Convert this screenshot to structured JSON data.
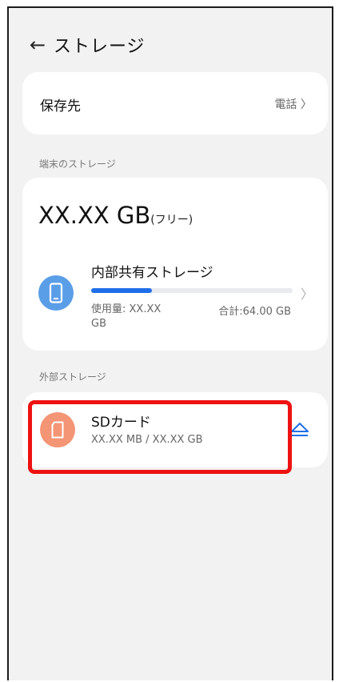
{
  "header": {
    "back_icon": "arrow-left-icon",
    "title": "ストレージ"
  },
  "save_location": {
    "label": "保存先",
    "value": "電話",
    "chevron_icon": "chevron-right-icon"
  },
  "device_section": {
    "heading": "端末のストレージ",
    "free_amount": "XX.XX GB",
    "free_label": "(フリー)",
    "internal": {
      "icon": "phone-icon",
      "name": "内部共有ストレージ",
      "used_fraction": 0.3,
      "used_text": "使用量: XX.XX GB",
      "total_text": "合計:64.00 GB",
      "chevron_icon": "chevron-right-icon"
    }
  },
  "external_section": {
    "heading": "外部ストレージ",
    "sd": {
      "icon": "sd-card-icon",
      "name": "SDカード",
      "usage": "XX.XX MB / XX.XX GB",
      "eject_icon": "eject-icon"
    }
  },
  "colors": {
    "accent": "#1f6fe8",
    "internal_icon_bg": "#5b9ee8",
    "sd_icon_bg": "#f49575",
    "highlight": "#ee1111"
  }
}
